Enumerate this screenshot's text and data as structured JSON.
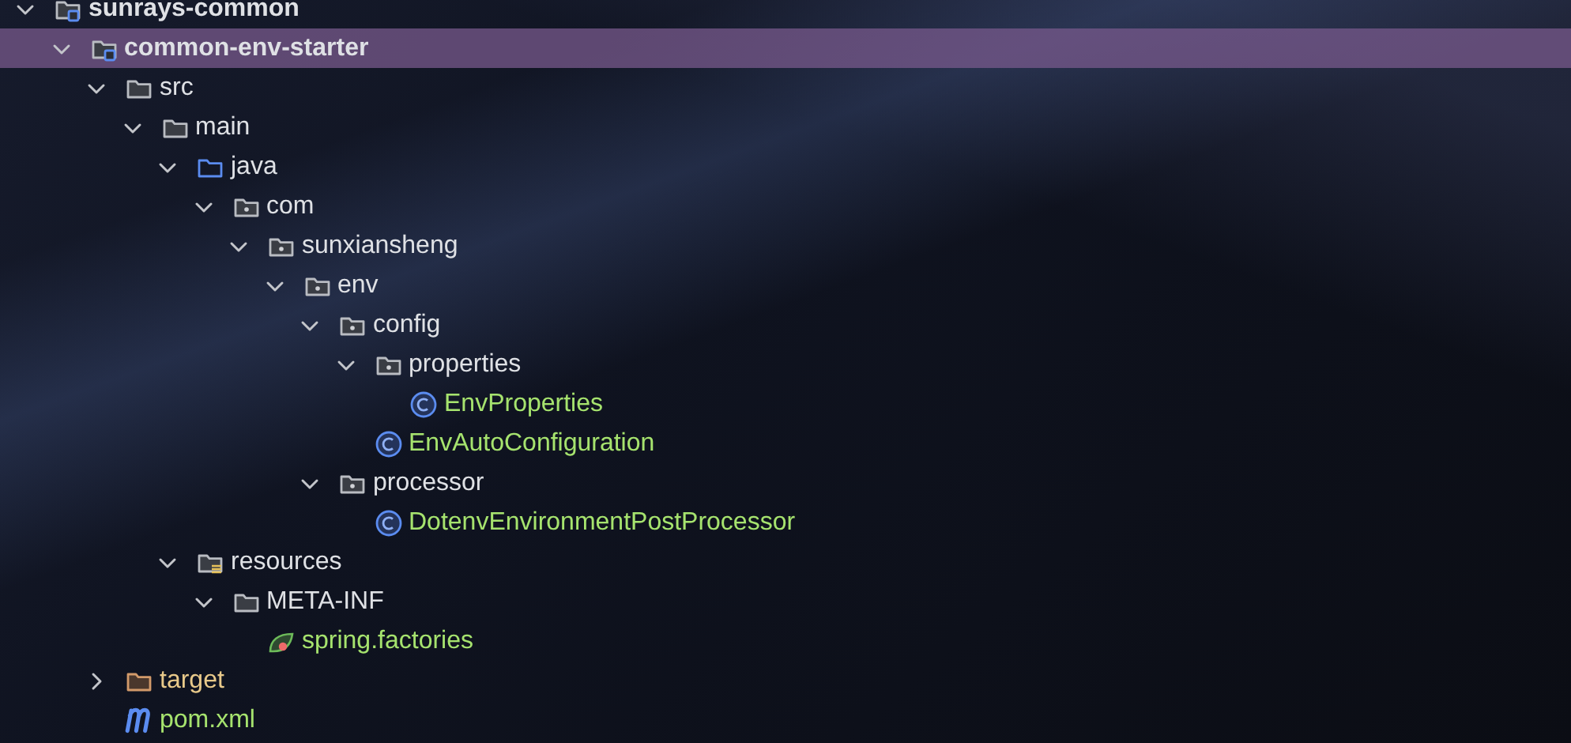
{
  "tree": [
    {
      "label": "sunrays-common",
      "kind": "module",
      "expanded": true,
      "selected": false,
      "children": [
        {
          "label": "common-env-starter",
          "kind": "module",
          "expanded": true,
          "selected": true,
          "children": [
            {
              "label": "src",
              "kind": "folder",
              "expanded": true,
              "selected": false,
              "children": [
                {
                  "label": "main",
                  "kind": "folder",
                  "expanded": true,
                  "selected": false,
                  "children": [
                    {
                      "label": "java",
                      "kind": "source-folder",
                      "expanded": true,
                      "selected": false,
                      "children": [
                        {
                          "label": "com",
                          "kind": "package",
                          "expanded": true,
                          "selected": false,
                          "children": [
                            {
                              "label": "sunxiansheng",
                              "kind": "package",
                              "expanded": true,
                              "selected": false,
                              "children": [
                                {
                                  "label": "env",
                                  "kind": "package",
                                  "expanded": true,
                                  "selected": false,
                                  "children": [
                                    {
                                      "label": "config",
                                      "kind": "package",
                                      "expanded": true,
                                      "selected": false,
                                      "children": [
                                        {
                                          "label": "properties",
                                          "kind": "package",
                                          "expanded": true,
                                          "selected": false,
                                          "children": [
                                            {
                                              "label": "EnvProperties",
                                              "kind": "class",
                                              "selected": false
                                            }
                                          ]
                                        },
                                        {
                                          "label": "EnvAutoConfiguration",
                                          "kind": "class",
                                          "selected": false
                                        }
                                      ]
                                    },
                                    {
                                      "label": "processor",
                                      "kind": "package",
                                      "expanded": true,
                                      "selected": false,
                                      "children": [
                                        {
                                          "label": "DotenvEnvironmentPostProcessor",
                                          "kind": "class",
                                          "selected": false
                                        }
                                      ]
                                    }
                                  ]
                                }
                              ]
                            }
                          ]
                        }
                      ]
                    },
                    {
                      "label": "resources",
                      "kind": "resources",
                      "expanded": true,
                      "selected": false,
                      "children": [
                        {
                          "label": "META-INF",
                          "kind": "folder",
                          "expanded": true,
                          "selected": false,
                          "children": [
                            {
                              "label": "spring.factories",
                              "kind": "spring",
                              "selected": false
                            }
                          ]
                        }
                      ]
                    }
                  ]
                }
              ]
            },
            {
              "label": "target",
              "kind": "excluded",
              "expanded": false,
              "selected": false
            },
            {
              "label": "pom.xml",
              "kind": "maven",
              "selected": false
            }
          ]
        }
      ]
    }
  ]
}
